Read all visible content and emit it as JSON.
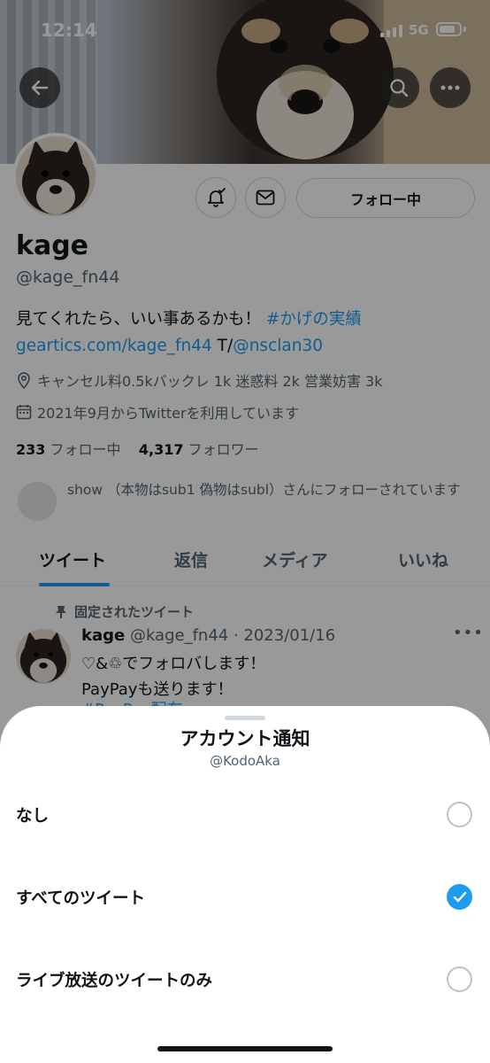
{
  "status_bar": {
    "time": "12:14",
    "network": "5G"
  },
  "nav": {
    "back_icon": "back-arrow-icon",
    "search_icon": "search-icon",
    "more_icon": "more-icon"
  },
  "profile": {
    "follow_button": "フォロー中",
    "name": "kage",
    "handle": "@kage_fn44",
    "bio_line1_text": "見てくれたら、いい事あるかも！ ",
    "bio_line1_tag": "#かげの実績",
    "bio_line2_link": "geartics.com/kage_fn44",
    "bio_line2_text": " T/",
    "bio_line2_mention": "@nsclan30",
    "location": "キャンセル料0.5kバックレ 1k 迷惑料 2k 営業妨害 3k",
    "joined": "2021年9月からTwitterを利用しています",
    "following_count": "233",
    "following_label": "フォロー中",
    "followers_count": "4,317",
    "followers_label": "フォロワー",
    "followed_by": "show （本物はsub1 偽物はsubl）さんにフォローされています"
  },
  "tabs": [
    "ツイート",
    "返信",
    "メディア",
    "いいね"
  ],
  "pinned_tweet": {
    "pinned_label": "固定されたツイート",
    "name": "kage",
    "meta": "@kage_fn44 · 2023/01/16",
    "line1": "♡&♲でフォロバします！",
    "line2": "PayPayも送ります！",
    "line3": "#PayPay配布"
  },
  "sheet": {
    "title": "アカウント通知",
    "subtitle": "@KodoAka",
    "options": [
      {
        "label": "なし",
        "selected": false
      },
      {
        "label": "すべてのツイート",
        "selected": true
      },
      {
        "label": "ライブ放送のツイートのみ",
        "selected": false
      }
    ]
  },
  "colors": {
    "accent": "#1d9bf0",
    "text": "#0f1419",
    "secondary": "#536471"
  }
}
